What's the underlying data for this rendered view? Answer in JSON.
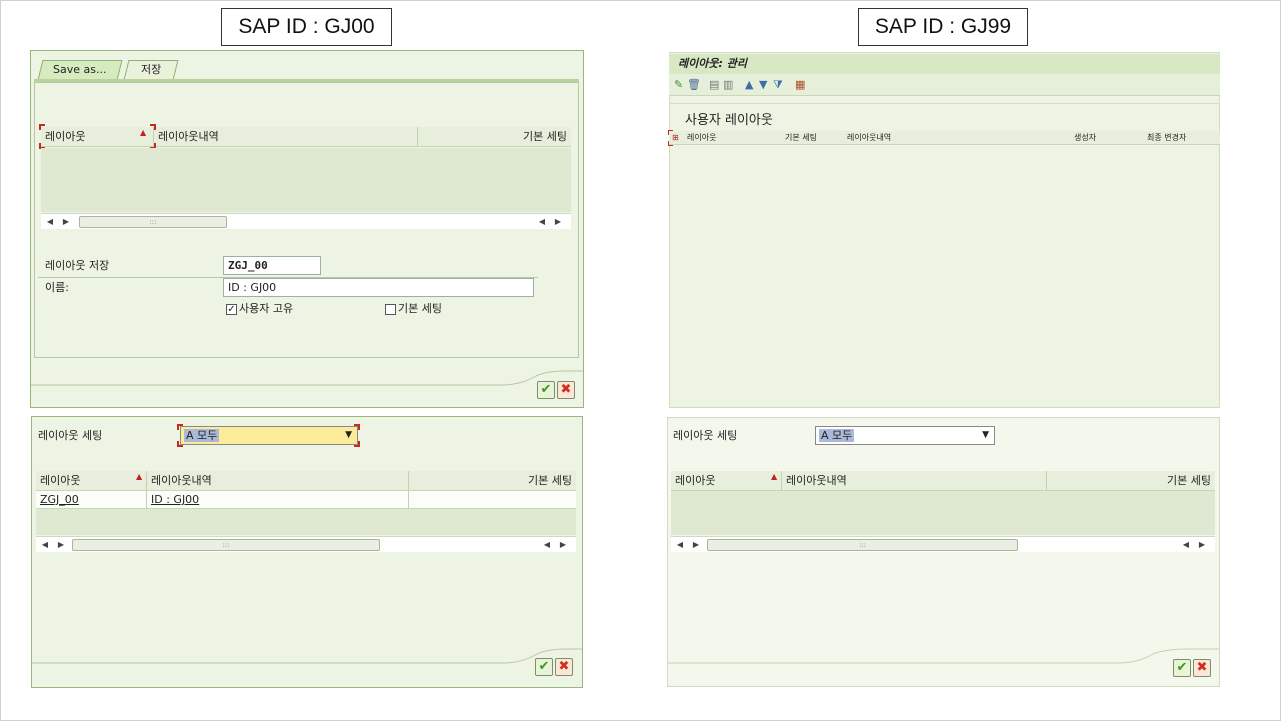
{
  "gj00": {
    "sap_id_label": "SAP ID : GJ00",
    "save_dialog": {
      "tabs": [
        "Save as...",
        "저장"
      ],
      "columns": [
        "레이아웃",
        "레이아웃내역",
        "기본 세팅"
      ],
      "save_layout_label": "레이아웃 저장",
      "save_layout_value": "ZGJ_00",
      "name_label": "이름:",
      "name_value": "ID : GJ00",
      "user_specific_label": "사용자 고유",
      "user_specific_checked": true,
      "default_setting_label": "기본 세팅",
      "default_setting_checked": false,
      "ok_icon": "check-icon",
      "cancel_icon": "cancel-x-icon"
    },
    "select_dialog": {
      "layout_setting_label": "레이아웃 세팅",
      "layout_setting_value": "A 모두",
      "columns": [
        "레이아웃",
        "레이아웃내역",
        "기본 세팅"
      ],
      "rows": [
        {
          "layout": "ZGJ_00",
          "description": "ID : GJ00",
          "default": ""
        }
      ]
    }
  },
  "gj99": {
    "sap_id_label": "SAP ID : GJ99",
    "manage_window": {
      "title": "레이아웃: 관리",
      "toolbar_icons": [
        "edit-icon",
        "delete-icon",
        "details-icon",
        "transport-icon",
        "sort-ascending-icon",
        "sort-descending-icon",
        "filter-icon",
        "grid-icon"
      ],
      "section_title": "사용자 레이아웃",
      "columns": [
        "레이아웃",
        "기본 세팅",
        "레이아웃내역",
        "생성자",
        "최종 변경자"
      ]
    },
    "select_dialog": {
      "layout_setting_label": "레이아웃 세팅",
      "layout_setting_value": "A 모두",
      "columns": [
        "레이아웃",
        "레이아웃내역",
        "기본 세팅"
      ],
      "rows": []
    }
  },
  "colors": {
    "panel_bg": "#eef4e3",
    "panel_border": "#9ab77a",
    "selection": "#aab9d8",
    "focus_field": "#fcec9a",
    "ok_green": "#3a9b1e",
    "cancel_red": "#d2301c"
  }
}
